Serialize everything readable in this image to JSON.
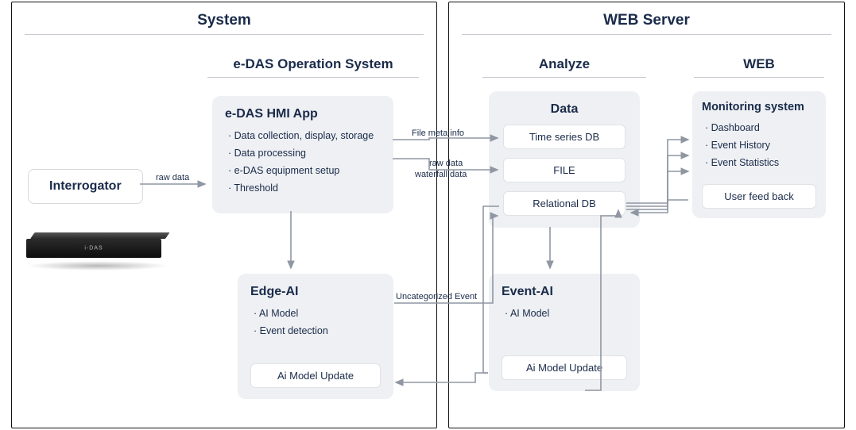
{
  "system": {
    "title": "System",
    "interrogator": "Interrogator",
    "edas_os": {
      "title": "e-DAS Operation System",
      "hmi": {
        "title": "e-DAS HMI App",
        "items": [
          "Data collection, display, storage",
          "Data processing",
          "e-DAS equipment setup",
          "Threshold"
        ]
      },
      "edge_ai": {
        "title": "Edge-AI",
        "items": [
          "AI Model",
          "Event detection"
        ],
        "update_btn": "Ai Model Update"
      }
    }
  },
  "web_server": {
    "title": "WEB Server",
    "analyze": {
      "title": "Analyze",
      "data": {
        "title": "Data",
        "chips": [
          "Time series DB",
          "FILE",
          "Relational DB"
        ]
      },
      "event_ai": {
        "title": "Event-AI",
        "items": [
          "AI Model"
        ],
        "update_btn": "Ai Model Update"
      }
    },
    "web": {
      "title": "WEB",
      "monitoring": {
        "title": "Monitoring system",
        "items": [
          "Dashboard",
          "Event History",
          "Event Statistics"
        ],
        "feedback_btn": "User feed back"
      }
    }
  },
  "arrow_labels": {
    "raw_data": "raw data",
    "file_meta": "File meta info",
    "raw_data_wf1": "raw data",
    "raw_data_wf2": "waterfall data",
    "uncategorized": "Uncategorized Event"
  }
}
